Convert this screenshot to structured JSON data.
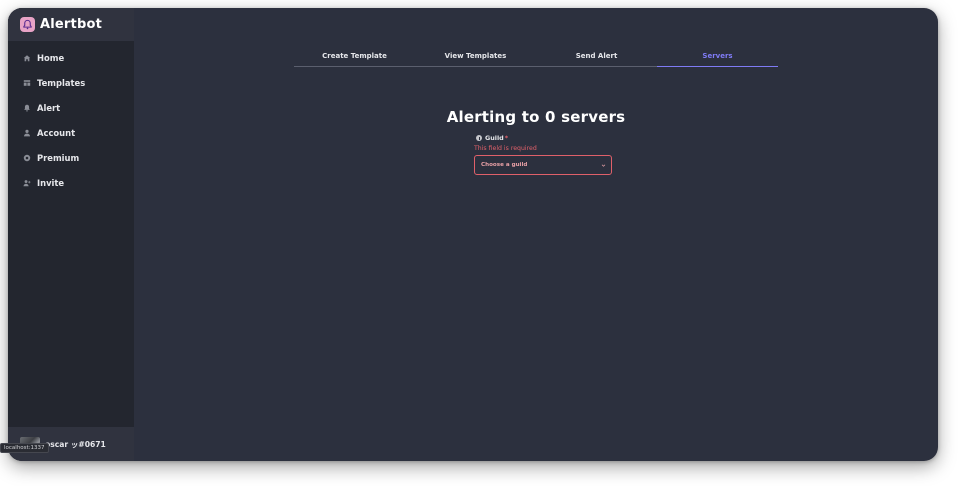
{
  "app": {
    "title": "Alertbot",
    "logo_icon": "bell-icon",
    "accent_color": "#7f7bf5",
    "error_color": "#e0606a"
  },
  "sidebar": {
    "items": [
      {
        "label": "Home",
        "icon": "home-icon"
      },
      {
        "label": "Templates",
        "icon": "templates-icon"
      },
      {
        "label": "Alert",
        "icon": "bell-icon"
      },
      {
        "label": "Account",
        "icon": "user-icon"
      },
      {
        "label": "Premium",
        "icon": "premium-icon"
      },
      {
        "label": "Invite",
        "icon": "invite-icon"
      }
    ]
  },
  "user": {
    "name": "oscar ッ#0671"
  },
  "status_bar": {
    "url": "localhost:1337"
  },
  "tabs": [
    {
      "label": "Create Template",
      "active": false
    },
    {
      "label": "View Templates",
      "active": false
    },
    {
      "label": "Send Alert",
      "active": false
    },
    {
      "label": "Servers",
      "active": true
    }
  ],
  "main": {
    "heading": "Alerting to 0 servers"
  },
  "form": {
    "guild_label": "Guild",
    "required_mark": "*",
    "error": "This field is required",
    "select_placeholder": "Choose a guild"
  }
}
